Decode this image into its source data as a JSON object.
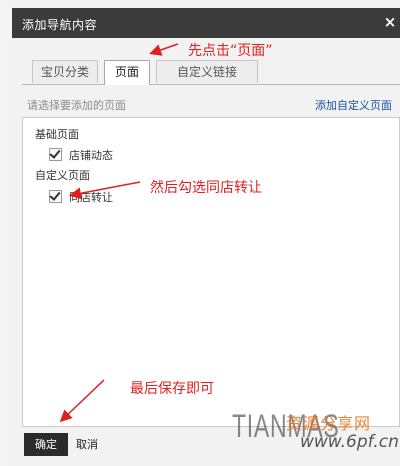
{
  "dialog": {
    "title": "添加导航内容",
    "close_glyph": "×"
  },
  "tabs": [
    {
      "label": "宝贝分类",
      "active": false
    },
    {
      "label": "页面",
      "active": true
    },
    {
      "label": "自定义链接",
      "active": false
    }
  ],
  "subheader": {
    "prompt": "请选择要添加的页面",
    "add_custom_link": "添加自定义页面"
  },
  "groups": [
    {
      "label": "基础页面",
      "items": [
        {
          "label": "店铺动态",
          "checked": true
        }
      ]
    },
    {
      "label": "自定义页面",
      "items": [
        {
          "label": "同店转让",
          "checked": true
        }
      ]
    }
  ],
  "buttons": {
    "ok": "确定",
    "cancel": "取消"
  },
  "annotations": {
    "step1": "先点击“页面”",
    "step2": "然后勾选同店转让",
    "step3": "最后保存即可"
  },
  "watermark": {
    "main": "TIANMAS",
    "cn": "资源分享网",
    "url": "www.6pf.cn"
  },
  "colors": {
    "annotation": "#e02020",
    "title_bar": "#3b3b3b",
    "link": "#1a4fa3"
  }
}
